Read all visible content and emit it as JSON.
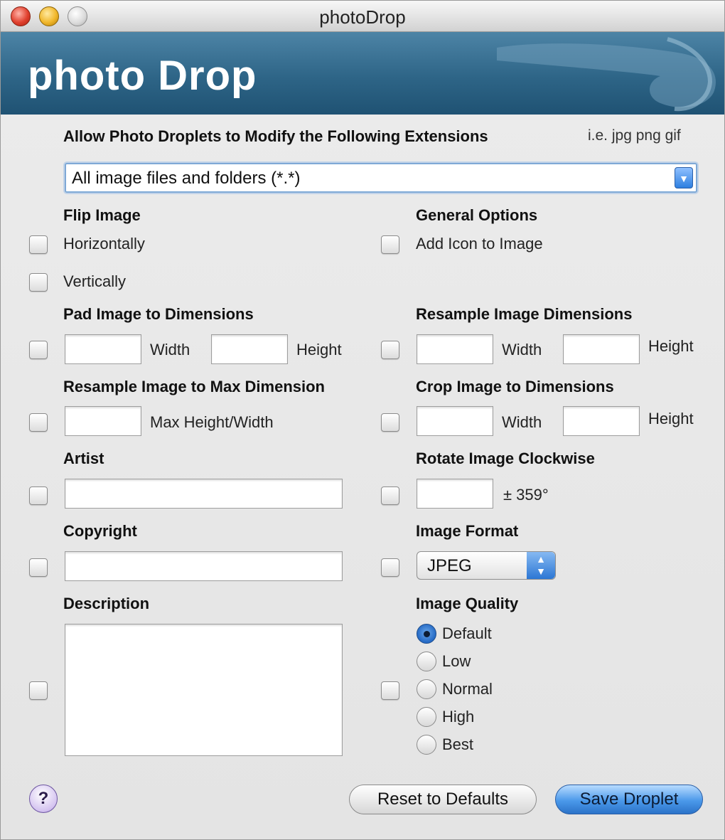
{
  "window": {
    "title": "photoDrop"
  },
  "banner": {
    "title": "photo Drop"
  },
  "extensions": {
    "label": "Allow Photo Droplets to Modify the Following Extensions",
    "hint": "i.e. jpg png gif",
    "value": "All image files and folders (*.*)"
  },
  "flip": {
    "label": "Flip Image",
    "horizontal": "Horizontally",
    "vertical": "Vertically"
  },
  "general": {
    "label": "General Options",
    "add_icon": "Add Icon to Image"
  },
  "pad": {
    "label": "Pad Image to Dimensions",
    "width": "Width",
    "height": "Height"
  },
  "resample": {
    "label": "Resample Image Dimensions",
    "width": "Width",
    "height": "Height"
  },
  "resample_max": {
    "label": "Resample Image to Max Dimension",
    "suffix": "Max Height/Width"
  },
  "crop": {
    "label": "Crop Image to Dimensions",
    "width": "Width",
    "height": "Height"
  },
  "artist": {
    "label": "Artist",
    "value": ""
  },
  "rotate": {
    "label": "Rotate Image Clockwise",
    "suffix": "± 359°"
  },
  "copyright": {
    "label": "Copyright",
    "value": ""
  },
  "format": {
    "label": "Image Format",
    "selected": "JPEG"
  },
  "description": {
    "label": "Description",
    "value": ""
  },
  "quality": {
    "label": "Image Quality",
    "options": [
      "Default",
      "Low",
      "Normal",
      "High",
      "Best"
    ],
    "selected": "Default"
  },
  "footer": {
    "help": "?",
    "reset": "Reset to Defaults",
    "save": "Save Droplet"
  }
}
